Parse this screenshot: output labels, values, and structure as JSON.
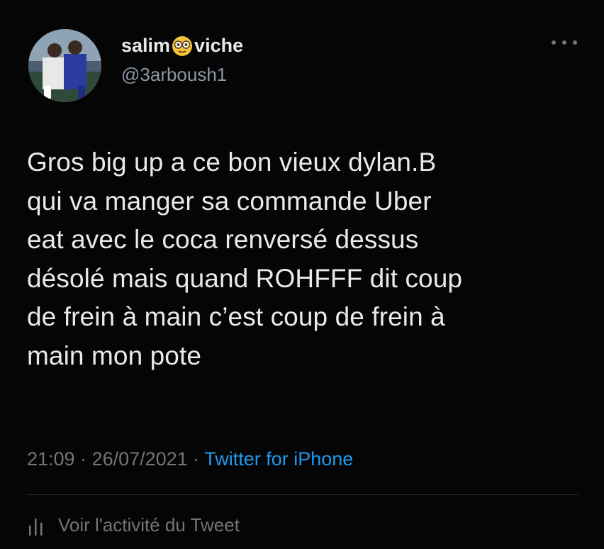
{
  "author": {
    "name_part1": "salim",
    "name_emoji": "face-with-monocle",
    "name_part2": "viche",
    "handle": "@3arboush1"
  },
  "tweet": {
    "text": "Gros big up a ce bon vieux dylan.B\nqui va manger sa commande Uber\neat avec le coca renversé dessus\ndésolé mais quand ROHFFF dit coup\nde frein à main c’est coup de frein à\nmain mon pote",
    "time": "21:09",
    "separator1": " · ",
    "date": "26/07/2021",
    "separator2": " · ",
    "source": "Twitter for iPhone"
  },
  "footer": {
    "activity_label": "Voir l'activité du Tweet",
    "activity_icon": "analytics-bars-icon"
  },
  "colors": {
    "background": "#050505",
    "text_primary": "#e7e9ea",
    "text_secondary": "#71767b",
    "link": "#1d9bf0"
  }
}
